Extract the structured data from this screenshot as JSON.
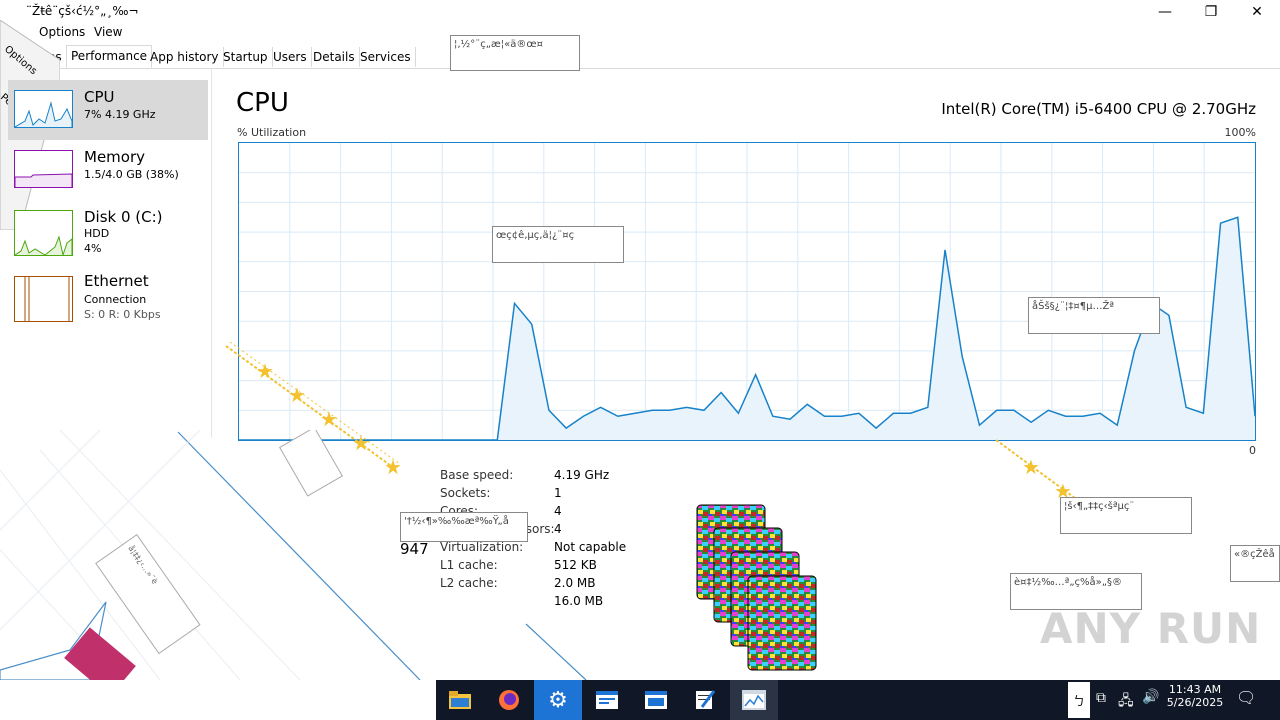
{
  "window": {
    "title": "¨Žŧê¨çš‹ć½°„¸‰¬",
    "controls": [
      "minimize",
      "restore",
      "close"
    ]
  },
  "menu": {
    "items": [
      "Options",
      "View"
    ]
  },
  "tabs": {
    "partial_first": "es",
    "items": [
      "Performance",
      "App history",
      "Startup",
      "Users",
      "Details",
      "Services"
    ],
    "active": "Performance"
  },
  "sidebar": {
    "items": [
      {
        "title": "CPU",
        "sub1": "7%  4.19 GHz",
        "sub2": "",
        "color": "#1782c9"
      },
      {
        "title": "Memory",
        "sub1": "1.5/4.0 GB (38%)",
        "sub2": "",
        "color": "#8b12ae"
      },
      {
        "title": "Disk 0 (C:)",
        "sub1": "HDD",
        "sub2": "4%",
        "color": "#4da60c"
      },
      {
        "title": "Ethernet",
        "sub1": "Connection",
        "sub2": "S: 0  R: 0 Kbps",
        "color": "#a74f01"
      }
    ]
  },
  "main": {
    "title": "CPU",
    "processor": "Intel(R) Core(TM) i5-6400 CPU @ 2.70GHz",
    "util_label": "% Utilization",
    "max_label": "100%",
    "min_label": "0",
    "utilization_series": [
      0,
      0,
      0,
      0,
      0,
      0,
      0,
      0,
      0,
      0,
      0,
      0,
      0,
      0,
      0,
      0,
      46,
      39,
      10,
      4,
      8,
      11,
      8,
      9,
      10,
      10,
      11,
      10,
      16,
      9,
      22,
      8,
      7,
      12,
      8,
      8,
      9,
      4,
      9,
      9,
      11,
      64,
      28,
      5,
      10,
      10,
      6,
      10,
      8,
      8,
      9,
      5,
      30,
      46,
      42,
      11,
      9,
      73,
      75,
      8
    ],
    "stats": [
      {
        "label": "Base speed:",
        "value": "4.19 GHz"
      },
      {
        "label": "Sockets:",
        "value": "1"
      },
      {
        "label": "Cores:",
        "value": "4"
      },
      {
        "label": "Logical processors:",
        "value": "4"
      },
      {
        "label": "Virtualization:",
        "value": "Not capable"
      },
      {
        "label": "L1 cache:",
        "value": "512 KB"
      },
      {
        "label": "L2 cache:",
        "value": "2.0 MB"
      },
      {
        "label": "",
        "value": "16.0 MB"
      }
    ],
    "partial_number": "947"
  },
  "overlays": {
    "box1": "¦‚½°¨ç„æ¦«ä®œ¤",
    "box2": "œç¢ê‚µç‚ä¦¿¨¤ç",
    "box3": "åŠš§¿¨¦‡¤¶µ…Žª",
    "box4": "¦š‹¶„‡‡ç‹šªµç¨",
    "box5": "«®çŽêå",
    "box6": "è¤‡½‰…ª„ç%å»„§®",
    "box7": "'†½‹¶»‰‰æª‰Ÿ„å",
    "box8": "å¦‡‡¿‹…»¨è"
  },
  "taskbar": {
    "time": "11:43 AM",
    "date": "5/26/2025",
    "ime": "ㄅ",
    "apps": [
      "file-explorer",
      "firefox",
      "settings",
      "app-window-1",
      "app-window-2",
      "notepad-pen",
      "task-manager"
    ]
  },
  "watermark": "ANY RUN"
}
